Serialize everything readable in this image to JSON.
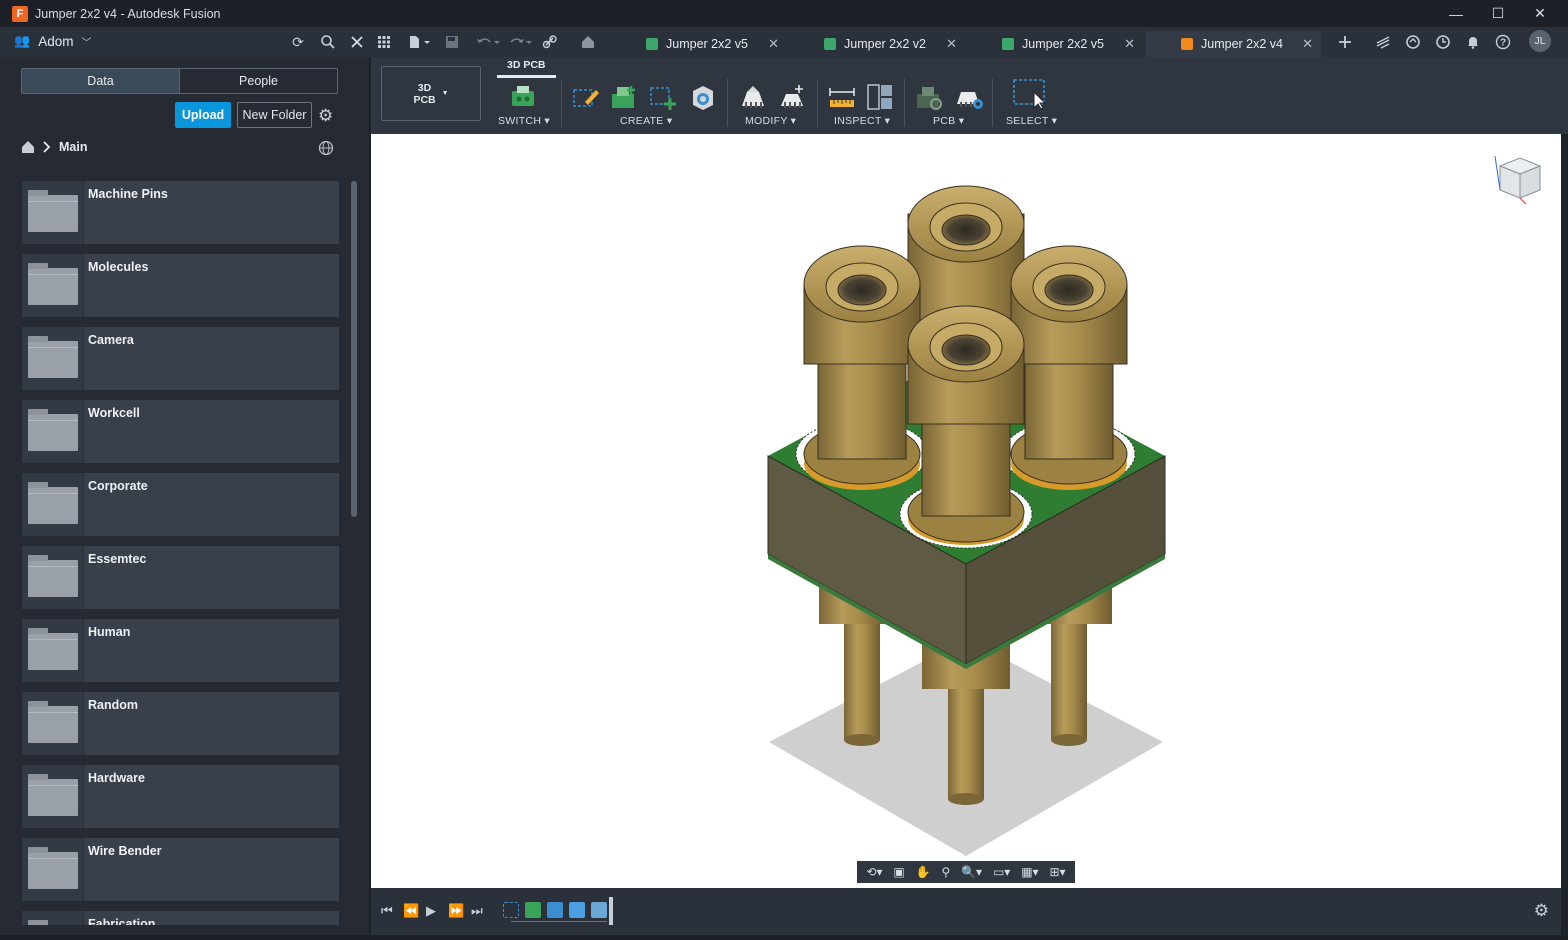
{
  "window": {
    "title": "Jumper 2x2 v4 - Autodesk Fusion",
    "logo_letter": "F",
    "minimize": "—",
    "maximize": "☐",
    "close": "✕"
  },
  "app_bar": {
    "team_name": "Adom",
    "user_initials": "JL"
  },
  "doc_tabs": [
    {
      "label": "Jumper 2x2 v5",
      "icon_color": "#3ea86b",
      "active": false
    },
    {
      "label": "Jumper 2x2 v2",
      "icon_color": "#3ea86b",
      "active": false
    },
    {
      "label": "Jumper 2x2 v5",
      "icon_color": "#3ea86b",
      "active": false
    },
    {
      "label": "Jumper 2x2 v4",
      "icon_color": "#f28a1e",
      "active": true
    }
  ],
  "sidebar": {
    "tabs": [
      "Data",
      "People"
    ],
    "active_tab": "Data",
    "upload_label": "Upload",
    "new_folder_label": "New Folder",
    "breadcrumb": "Main",
    "folders": [
      "Machine Pins",
      "Molecules",
      "Camera",
      "Workcell",
      "Corporate",
      "Essemtec",
      "Human",
      "Random",
      "Hardware",
      "Wire Bender",
      "Fabrication"
    ]
  },
  "toolbar": {
    "workspace_line1": "3D",
    "workspace_line2": "PCB",
    "workspace_tab": "3D PCB",
    "groups": [
      "SWITCH",
      "CREATE",
      "MODIFY",
      "INSPECT",
      "PCB",
      "SELECT"
    ]
  },
  "colors": {
    "accent_blue": "#0a96dd",
    "brass": "#a98e4e",
    "pcb_green": "#2f7d32",
    "board_side": "#5f5a44"
  }
}
